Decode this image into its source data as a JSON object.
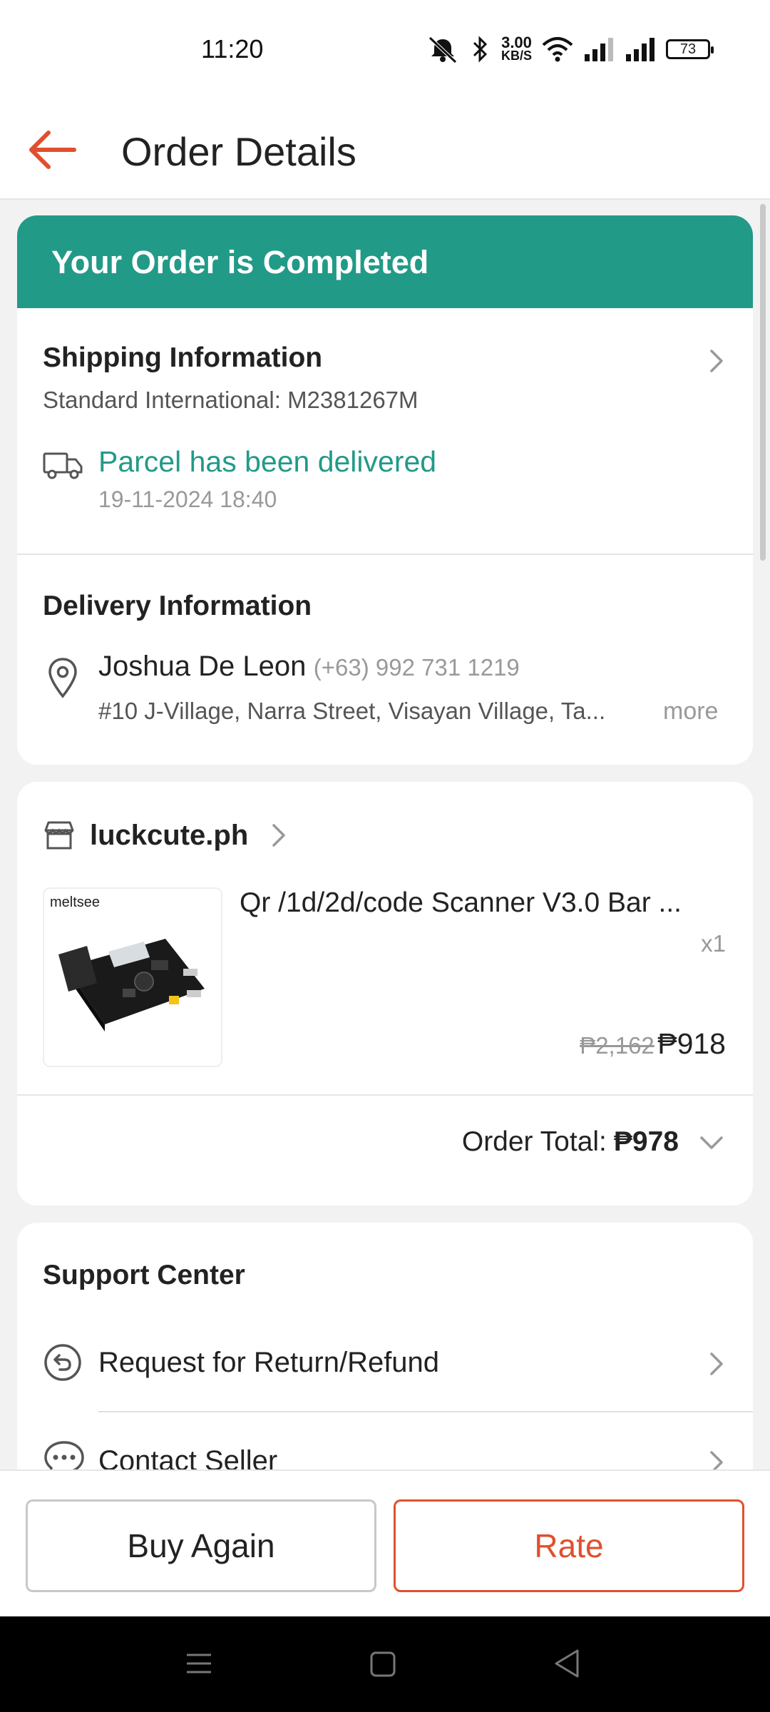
{
  "status_bar": {
    "time": "11:20",
    "net_speed_value": "3.00",
    "net_speed_unit": "KB/S",
    "battery": "73"
  },
  "header": {
    "title": "Order Details",
    "back_icon": "arrow-left-icon",
    "accent_color": "#e0502e"
  },
  "order_status": {
    "banner_text": "Your Order is Completed",
    "banner_color": "#229a88"
  },
  "shipping": {
    "title": "Shipping Information",
    "method": "Standard International: M2381267M",
    "status": "Parcel has been delivered",
    "status_time": "19-11-2024 18:40",
    "status_color": "#229a88"
  },
  "delivery": {
    "title": "Delivery Information",
    "name": "Joshua De Leon",
    "phone": "(+63) 992 731 1219",
    "address": "#10 J-Village, Narra Street, Visayan Village, Ta...",
    "more_label": "more"
  },
  "shop": {
    "name": "luckcute.ph",
    "product": {
      "image_brand": "meltsee",
      "title": "Qr /1d/2d/code Scanner V3.0 Bar ...",
      "quantity": "x1",
      "original_price": "₱2,162",
      "price": "₱918"
    },
    "order_total_label": "Order Total: ",
    "order_total_value": "₱978"
  },
  "support": {
    "title": "Support Center",
    "items": [
      {
        "label": "Request for Return/Refund",
        "icon": "return-icon"
      },
      {
        "label": "Contact Seller",
        "icon": "chat-icon"
      }
    ]
  },
  "actions": {
    "buy_again": "Buy Again",
    "rate": "Rate"
  }
}
